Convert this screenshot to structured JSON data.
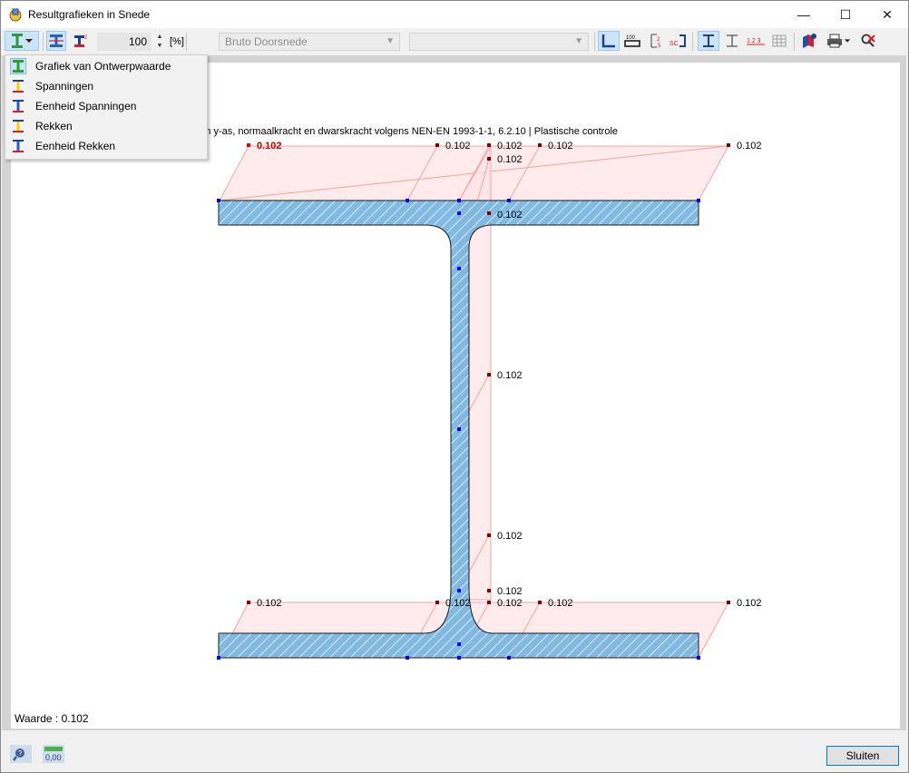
{
  "window": {
    "title": "Resultgrafieken in Snede",
    "minimize": "—",
    "maximize": "☐",
    "close": "✕"
  },
  "toolbar": {
    "zoom_value": "100",
    "zoom_unit": "[%]",
    "section_combo": "Bruto Doorsnede",
    "second_combo": "",
    "stepper_up": "▲",
    "stepper_down": "▼",
    "num_icon": "1 2 3",
    "scale_icon": "100",
    "sc_icon": "SC"
  },
  "menu": {
    "items": [
      {
        "label": "Grafiek van Ontwerpwaarde",
        "icon": "i-beam-green-icon",
        "selected": true
      },
      {
        "label": "Spanningen",
        "icon": "i-beam-yellow-icon",
        "selected": false
      },
      {
        "label": "Eenheid Spanningen",
        "icon": "i-beam-blue-icon",
        "selected": false
      },
      {
        "label": "Rekken",
        "icon": "i-beam-yellow-icon",
        "selected": false
      },
      {
        "label": "Eenheid Rekken",
        "icon": "i-beam-blue-icon",
        "selected": false
      }
    ]
  },
  "canvas": {
    "description_tail": "g om y-as, normaalkracht en dwarskracht volgens NEN-EN 1993-1-1, 6.2.10 | Plastische controle",
    "status_value": "Waarde : 0.102",
    "labels": {
      "top_left": "0.102",
      "top_mid": "0.102",
      "top_center": "0.102",
      "top_center_right": "0.102",
      "top_right": "0.102",
      "web_top_1": "0.102",
      "web_top_2": "0.102",
      "web_mid": "0.102",
      "web_low": "0.102",
      "web_bottom": "0.102",
      "bot_left": "0.102",
      "bot_mid": "0.102",
      "bot_center": "0.102",
      "bot_center_right": "0.102",
      "bot_right": "0.102"
    }
  },
  "footer": {
    "close_button": "Sluiten",
    "units_icon": "0,00"
  },
  "colors": {
    "section_fill": "#73b4e0",
    "section_stroke": "#1a1a1a",
    "diagram_fill": "#ffe3e3",
    "diagram_stroke": "#f2a3a3",
    "point": "#0000ff",
    "marker": "#800000",
    "max_marker": "#e60000",
    "accent": "#0078d7"
  }
}
